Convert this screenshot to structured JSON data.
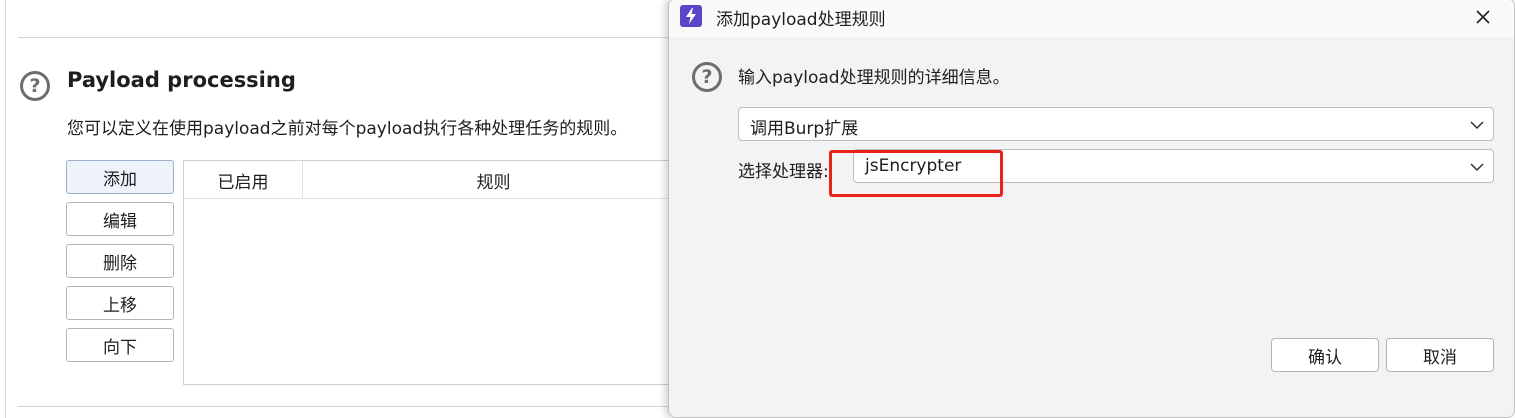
{
  "background": {
    "section_title": "Payload processing",
    "section_description": "您可以定义在使用payload之前对每个payload执行各种处理任务的规则。",
    "buttons": {
      "add": "添加",
      "edit": "编辑",
      "delete": "删除",
      "move_up": "上移",
      "move_down": "向下"
    },
    "table": {
      "columns": [
        "已启用",
        "规则"
      ],
      "rows": []
    }
  },
  "dialog": {
    "title": "添加payload处理规则",
    "description": "输入payload处理规则的详细信息。",
    "rule_type": {
      "selected": "调用Burp扩展"
    },
    "processor": {
      "label": "选择处理器:",
      "selected": "jsEncrypter"
    },
    "buttons": {
      "ok": "确认",
      "cancel": "取消"
    },
    "annotation_color": "#e8221b"
  },
  "icons": {
    "help": "help-circle-icon",
    "app": "burp-lightning-icon",
    "close": "close-icon",
    "dropdown": "chevron-down-icon"
  },
  "colors": {
    "app_icon": "#5b45c9",
    "dialog_bg": "#f3f3f3",
    "highlight": "#e8221b"
  }
}
